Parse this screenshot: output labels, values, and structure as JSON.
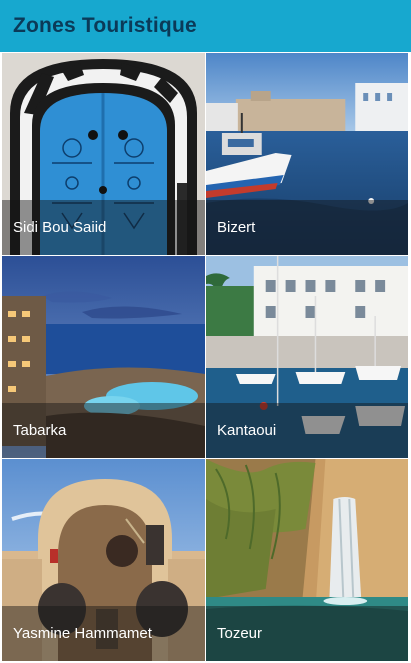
{
  "app": {
    "title": "Zones Touristique"
  },
  "zones": [
    {
      "name": "Sidi Bou Saiid",
      "icon": "blue-door-photo"
    },
    {
      "name": "Bizert",
      "icon": "harbor-boat-photo"
    },
    {
      "name": "Tabarka",
      "icon": "coast-resort-photo"
    },
    {
      "name": "Kantaoui",
      "icon": "marina-photo"
    },
    {
      "name": "Yasmine Hammamet",
      "icon": "arch-statues-photo"
    },
    {
      "name": "Tozeur",
      "icon": "oasis-waterfall-photo"
    }
  ],
  "colors": {
    "appbar": "#17a8cf",
    "title": "#0b3a58",
    "caption_overlay": "rgba(20,20,20,0.45)"
  }
}
